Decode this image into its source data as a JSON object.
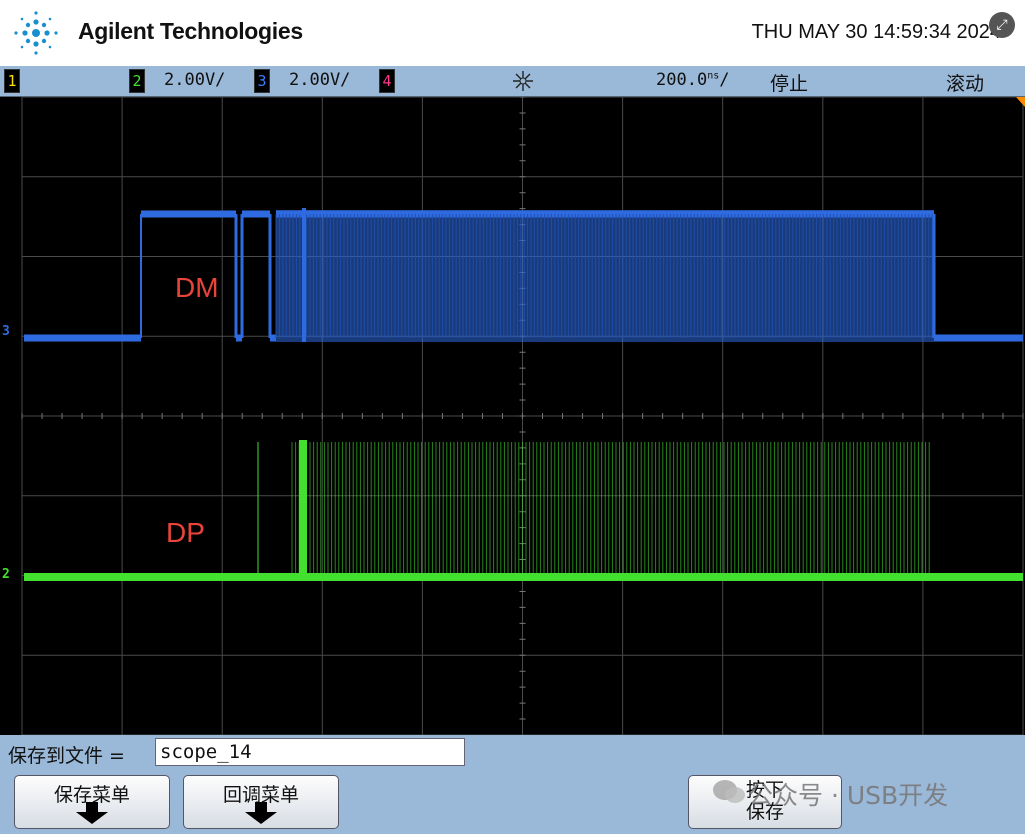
{
  "header": {
    "brand": "Agilent Technologies",
    "timestamp": "THU MAY 30 14:59:34 2024",
    "logo_icon": "agilent-spark-logo",
    "corner_icon": "expand-icon"
  },
  "status_bar": {
    "ch1": "1",
    "ch2": "2",
    "ch2_scale": "2.00V/",
    "ch3": "3",
    "ch3_scale": "2.00V/",
    "ch4": "4",
    "acquire_icon": "acquire-spark-icon",
    "timebase": "200.0",
    "timebase_unit": "ns",
    "timebase_suffix": "/",
    "run_state": "停止",
    "mode": "滚动"
  },
  "screen": {
    "grid_color": "#4a4a4a",
    "ch3_color": "#2f6be0",
    "ch2_color": "#44e02f",
    "ch3_marker": "3",
    "ch2_marker": "2",
    "annot_dm": "DM",
    "annot_dp": "DP"
  },
  "bottom": {
    "save_to_file_label": "保存到文件 =",
    "file_name": "scope_14",
    "btn_save_menu": "保存菜单",
    "btn_recall_menu": "回调菜单",
    "btn_press_save_line1": "按下",
    "btn_press_save_line2": "保存"
  },
  "watermark": {
    "text": "公众号 · USB开发"
  }
}
